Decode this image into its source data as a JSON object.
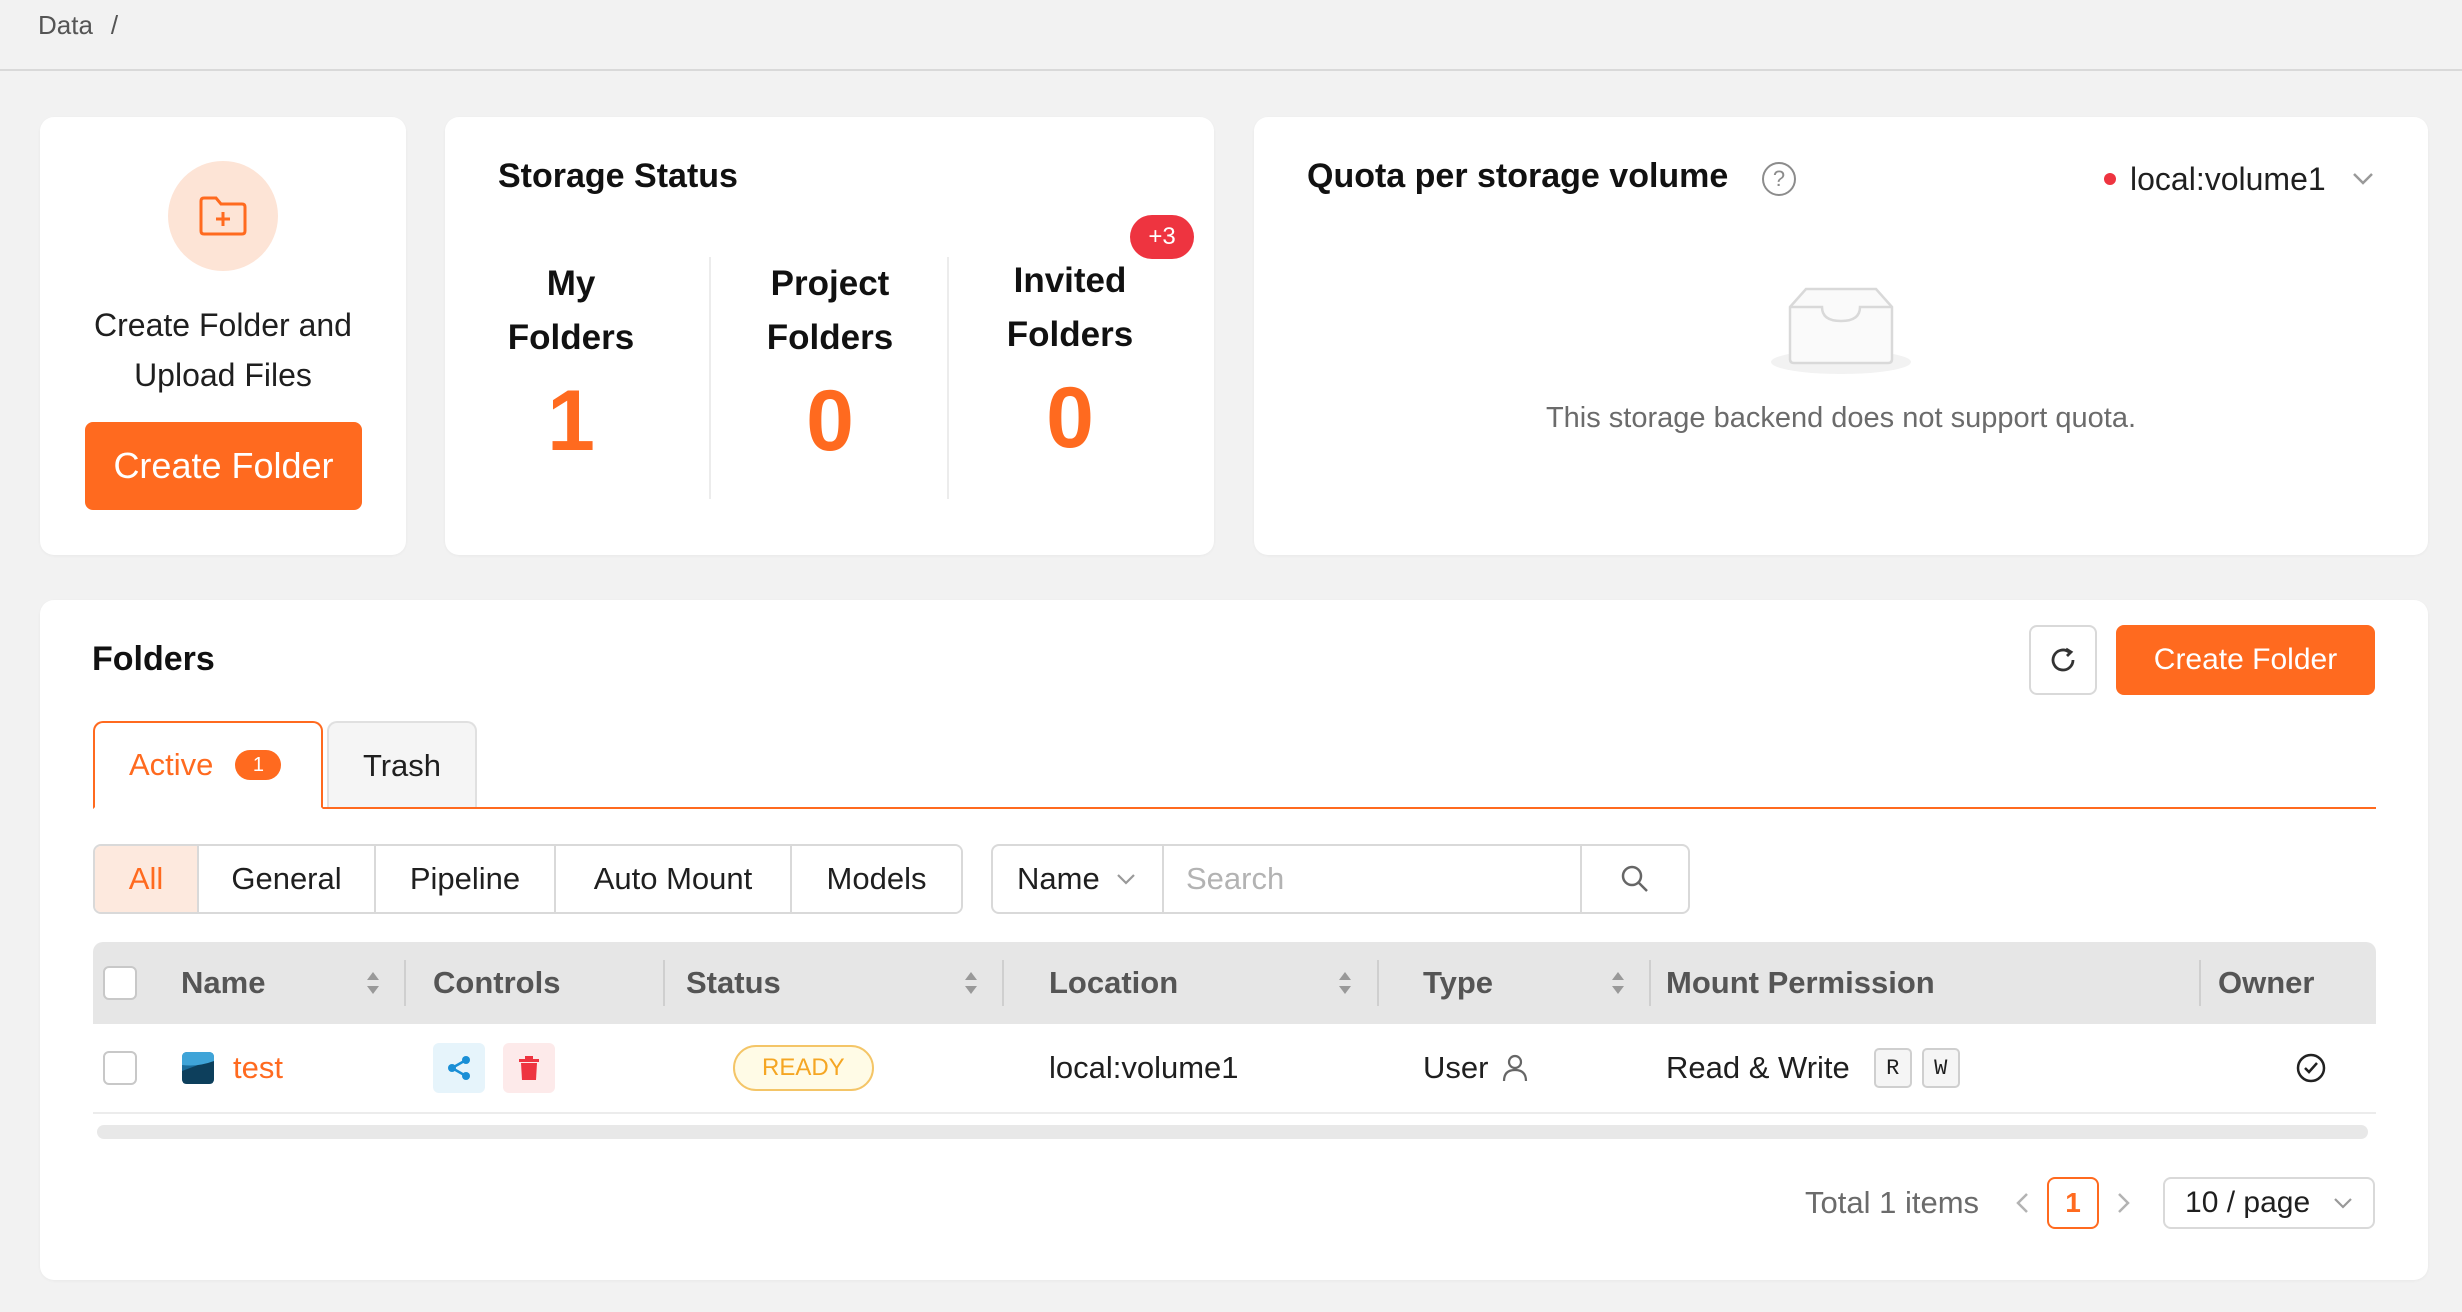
{
  "breadcrumb": {
    "item": "Data",
    "separator": "/"
  },
  "create_card": {
    "text_line1": "Create Folder and",
    "text_line2": "Upload Files",
    "button": "Create Folder"
  },
  "storage_status": {
    "title": "Storage Status",
    "my_folders": {
      "label1": "My",
      "label2": "Folders",
      "value": "1"
    },
    "project_folders": {
      "label1": "Project",
      "label2": "Folders",
      "value": "0"
    },
    "invited_folders": {
      "label1": "Invited",
      "label2": "Folders",
      "value": "0",
      "badge": "+3"
    }
  },
  "quota": {
    "title": "Quota per storage volume",
    "help": "?",
    "volume": "local:volume1",
    "empty_text": "This storage backend does not support quota."
  },
  "folders": {
    "title": "Folders",
    "create_button": "Create Folder",
    "tabs": {
      "active": "Active",
      "active_count": "1",
      "trash": "Trash"
    },
    "filters": [
      "All",
      "General",
      "Pipeline",
      "Auto Mount",
      "Models"
    ],
    "search": {
      "field": "Name",
      "placeholder": "Search"
    },
    "columns": {
      "name": "Name",
      "controls": "Controls",
      "status": "Status",
      "location": "Location",
      "type": "Type",
      "mount_permission": "Mount Permission",
      "owner": "Owner"
    },
    "rows": [
      {
        "name": "test",
        "status": "READY",
        "location": "local:volume1",
        "type": "User",
        "permission": "Read & Write",
        "perm_r": "R",
        "perm_w": "W"
      }
    ],
    "pagination": {
      "total": "Total 1 items",
      "current": "1",
      "page_size": "10 / page"
    }
  },
  "colors": {
    "accent": "#ff6a1f",
    "danger": "#ee3440",
    "ready": "#f5a623"
  },
  "icons": {
    "folder_add": "folder-add-icon",
    "help": "question-circle-icon",
    "empty": "inbox-icon",
    "refresh": "reload-icon",
    "search": "search-icon",
    "share": "share-icon",
    "delete": "trash-icon",
    "user": "user-icon",
    "owner": "check-circle-icon"
  }
}
